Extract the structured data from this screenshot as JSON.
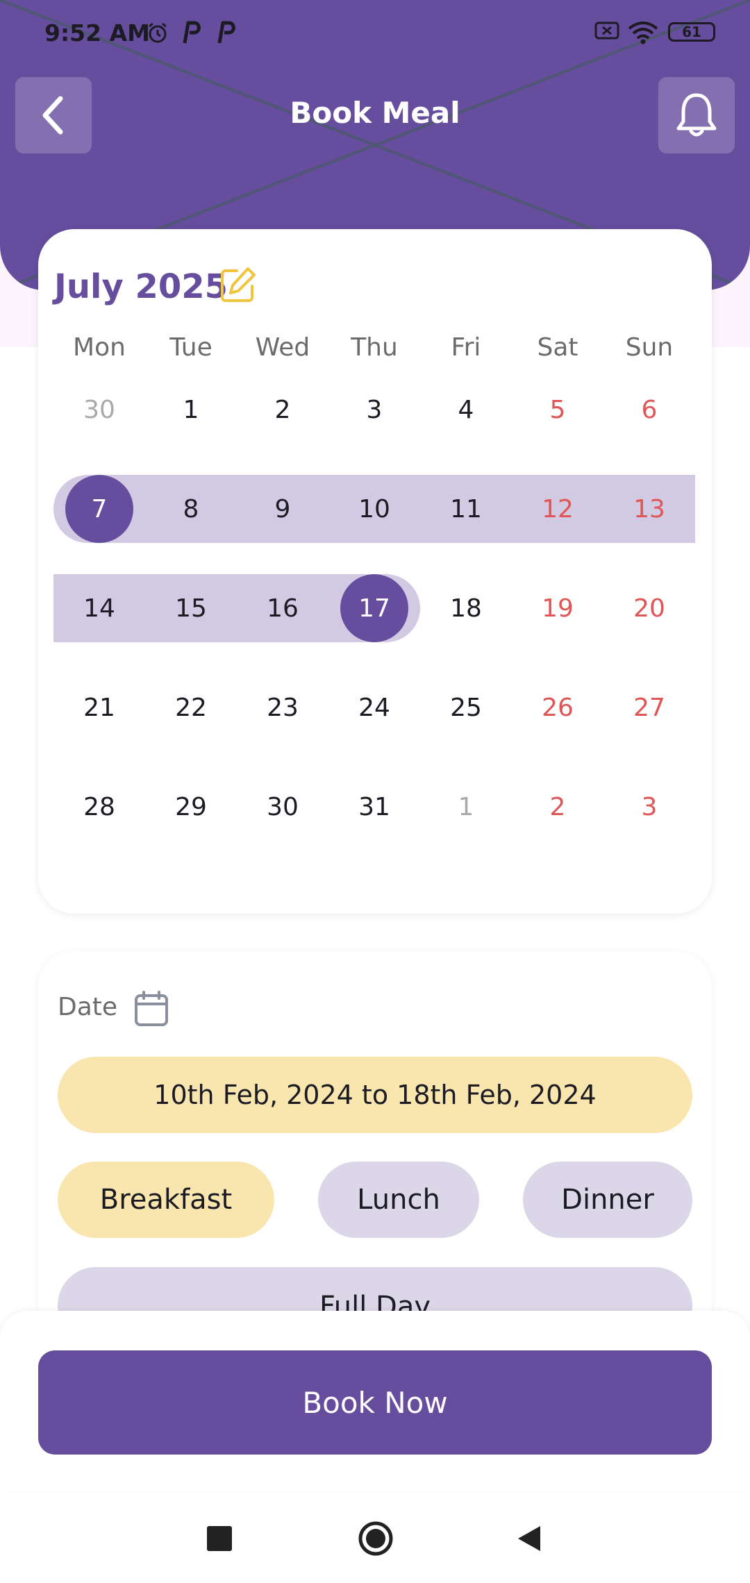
{
  "status_bar": {
    "time": "9:52 AM",
    "battery": "61",
    "icons": [
      "alarm-icon",
      "p-app-icon",
      "p-app-icon",
      "no-sim-icon",
      "wifi-icon",
      "battery-icon"
    ]
  },
  "header": {
    "title": "Book Meal",
    "back_icon": "chevron-left-icon",
    "bell_icon": "bell-icon"
  },
  "calendar": {
    "month_title": "July 2025",
    "edit_icon": "edit-icon",
    "weekdays": [
      "Mon",
      "Tue",
      "Wed",
      "Thu",
      "Fri",
      "Sat",
      "Sun"
    ],
    "weeks": [
      [
        "30",
        "1",
        "2",
        "3",
        "4",
        "5",
        "6"
      ],
      [
        "7",
        "8",
        "9",
        "10",
        "11",
        "12",
        "13"
      ],
      [
        "14",
        "15",
        "16",
        "17",
        "18",
        "19",
        "20"
      ],
      [
        "21",
        "22",
        "23",
        "24",
        "25",
        "26",
        "27"
      ],
      [
        "28",
        "29",
        "30",
        "31",
        "1",
        "2",
        "3"
      ]
    ],
    "range_start": "7",
    "range_end": "17"
  },
  "booking": {
    "date_label": "Date",
    "date_icon": "calendar-icon",
    "date_range": "10th Feb, 2024 to 18th Feb, 2024",
    "meals": [
      "Breakfast",
      "Lunch",
      "Dinner"
    ],
    "selected_meal": "Breakfast",
    "full_day": "Full Day"
  },
  "actions": {
    "book_now": "Book Now"
  },
  "colors": {
    "primary": "#664d9e",
    "range": "#d2cae2",
    "highlight": "#f9e5ae",
    "chip": "#dcd7e8",
    "weekend": "#e05555",
    "edit": "#f0c43c"
  },
  "nav_bar": {
    "icons": [
      "recents-icon",
      "home-icon",
      "back-icon"
    ]
  }
}
